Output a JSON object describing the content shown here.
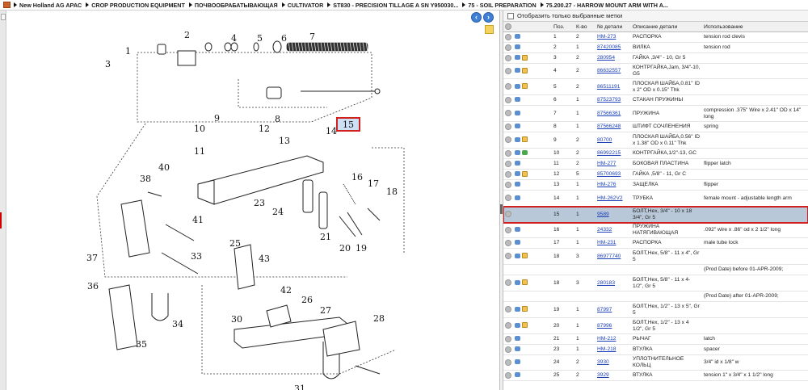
{
  "breadcrumb": [
    "New Holland AG APAC",
    "CROP PRODUCTION EQUIPMENT",
    "ПОЧВООБРАБАТЫВАЮЩАЯ",
    "CULTIVATOR",
    "ST830 - PRECISION TILLAGE A SN Y950030...",
    "75 - SOIL PREPARATION",
    "75.200.27 - HARROW MOUNT ARM WITH A..."
  ],
  "filter": {
    "label": "Отобразить только выбранные метки"
  },
  "columns": [
    "Поз.",
    "К-во",
    "№ детали",
    "Описание детали",
    "Использование"
  ],
  "diagram_labels": [
    "1",
    "2",
    "3",
    "4",
    "5",
    "6",
    "7",
    "8",
    "9",
    "10",
    "11",
    "12",
    "13",
    "14",
    "15",
    "16",
    "17",
    "18",
    "19",
    "20",
    "21",
    "23",
    "24",
    "25",
    "26",
    "27",
    "28",
    "30",
    "31",
    "33",
    "34",
    "35",
    "36",
    "37",
    "38",
    "40",
    "41",
    "42",
    "43"
  ],
  "selected_label": "15",
  "rows": [
    {
      "pos": "1",
      "qty": "2",
      "part": "HM-273",
      "desc": "РАСПОРКА",
      "use": "tension rod clevis",
      "icons": [
        "back"
      ]
    },
    {
      "pos": "2",
      "qty": "1",
      "part": "87420085",
      "desc": "ВИЛКА",
      "use": "tension rod",
      "icons": [
        "back"
      ]
    },
    {
      "pos": "3",
      "qty": "2",
      "part": "280954",
      "desc": "ГАЙКА ,3/4\" - 10, Gr 5",
      "use": "",
      "icons": [
        "back",
        "box"
      ]
    },
    {
      "pos": "4",
      "qty": "2",
      "part": "86632557",
      "desc": "КОНТРГАЙКА,Jam, 3/4\"-10, G5",
      "use": "",
      "icons": [
        "back",
        "box"
      ]
    },
    {
      "pos": "5",
      "qty": "2",
      "part": "86511191",
      "desc": "ПЛОСКАЯ ШАЙБА,0.81\" ID x 2\" OD x 0.15\" Thk",
      "use": "",
      "icons": [
        "back",
        "box"
      ]
    },
    {
      "pos": "6",
      "qty": "1",
      "part": "87523793",
      "desc": "СТАКАН ПРУЖИНЫ",
      "use": "",
      "icons": [
        "back"
      ]
    },
    {
      "pos": "7",
      "qty": "1",
      "part": "87566361",
      "desc": "ПРУЖИНА",
      "use": "compression .375\" Wire x 2.41\" OD x 14\" long",
      "icons": [
        "back"
      ]
    },
    {
      "pos": "8",
      "qty": "1",
      "part": "87566248",
      "desc": "ШТИФТ СОЧЛЕНЕНИЯ",
      "use": "spring",
      "icons": [
        "back"
      ]
    },
    {
      "pos": "9",
      "qty": "2",
      "part": "80700",
      "desc": "ПЛОСКАЯ ШАЙБА,0.56\" ID x 1.38\" OD x 0.11\" Thk",
      "use": "",
      "icons": [
        "back",
        "box"
      ]
    },
    {
      "pos": "10",
      "qty": "2",
      "part": "86992215",
      "desc": "КОНТРГАЙКА,1/2\"-13, GC",
      "use": "",
      "icons": [
        "back",
        "green"
      ]
    },
    {
      "pos": "11",
      "qty": "2",
      "part": "HM-277",
      "desc": "БОКОВАЯ ПЛАСТИНА",
      "use": "flipper latch",
      "icons": [
        "back"
      ]
    },
    {
      "pos": "12",
      "qty": "5",
      "part": "85700693",
      "desc": "ГАЙКА ,5/8\" - 11, Gr C",
      "use": "",
      "icons": [
        "back",
        "box"
      ]
    },
    {
      "pos": "13",
      "qty": "1",
      "part": "HM-276",
      "desc": "ЗАЩЕЛКА",
      "use": "flipper",
      "icons": [
        "back"
      ]
    },
    {
      "pos": "14",
      "qty": "1",
      "part": "HM-262V2",
      "desc": "ТРУБКА",
      "use": "female mount - adjustable length arm",
      "icons": [
        "back"
      ]
    },
    {
      "pos": "15",
      "qty": "1",
      "part": "9589",
      "desc": "БОЛТ,Hex, 3/4\" - 10 x 18 3/4\", Gr 5",
      "use": "",
      "icons": [],
      "selected": true
    },
    {
      "pos": "16",
      "qty": "1",
      "part": "24332",
      "desc": "ПРУЖИНА НАТЯГИВАЮЩАЯ",
      "use": ".092\" wire x .86\" od x 2 1/2\" long",
      "icons": [
        "back"
      ]
    },
    {
      "pos": "17",
      "qty": "1",
      "part": "HM-231",
      "desc": "РАСПОРКА",
      "use": "male tube lock",
      "icons": [
        "back"
      ]
    },
    {
      "pos": "18",
      "qty": "3",
      "part": "86977740",
      "desc": "БОЛТ,Hex, 5/8\" - 11 x 4\", Gr 5",
      "use": "",
      "icons": [
        "back",
        "box"
      ]
    },
    {
      "pos": "",
      "qty": "",
      "part": "",
      "desc": "",
      "use": "(Prod Date) before 01-APR-2009;",
      "icons": []
    },
    {
      "pos": "18",
      "qty": "3",
      "part": "280183",
      "desc": "БОЛТ,Hex, 5/8\" - 11 x 4-1/2\", Gr 5",
      "use": "",
      "icons": [
        "back",
        "box"
      ]
    },
    {
      "pos": "",
      "qty": "",
      "part": "",
      "desc": "",
      "use": "(Prod Date) after 01-APR-2009;",
      "icons": []
    },
    {
      "pos": "19",
      "qty": "1",
      "part": "87997",
      "desc": "БОЛТ,Hex, 1/2\" - 13 x 5\", Gr 5",
      "use": "",
      "icons": [
        "back",
        "box"
      ]
    },
    {
      "pos": "20",
      "qty": "1",
      "part": "87996",
      "desc": "БОЛТ,Hex, 1/2\" - 13 x 4 1/2\", Gr 5",
      "use": "",
      "icons": [
        "back",
        "box"
      ]
    },
    {
      "pos": "21",
      "qty": "1",
      "part": "HM-212",
      "desc": "РЫЧАГ",
      "use": "latch",
      "icons": [
        "back"
      ]
    },
    {
      "pos": "23",
      "qty": "1",
      "part": "HM-218",
      "desc": "ВТУЛКА",
      "use": "spacer",
      "icons": [
        "back"
      ]
    },
    {
      "pos": "24",
      "qty": "2",
      "part": "3930",
      "desc": "УПЛОТНИТЕЛЬНОЕ КОЛЬЦ",
      "use": "3/4\" id x 1/8\" w",
      "icons": [
        "back"
      ]
    },
    {
      "pos": "25",
      "qty": "2",
      "part": "3929",
      "desc": "ВТУЛКА",
      "use": "tension 1\" x 3/4\" x 1 1/2\" long",
      "icons": [
        "back"
      ]
    }
  ]
}
